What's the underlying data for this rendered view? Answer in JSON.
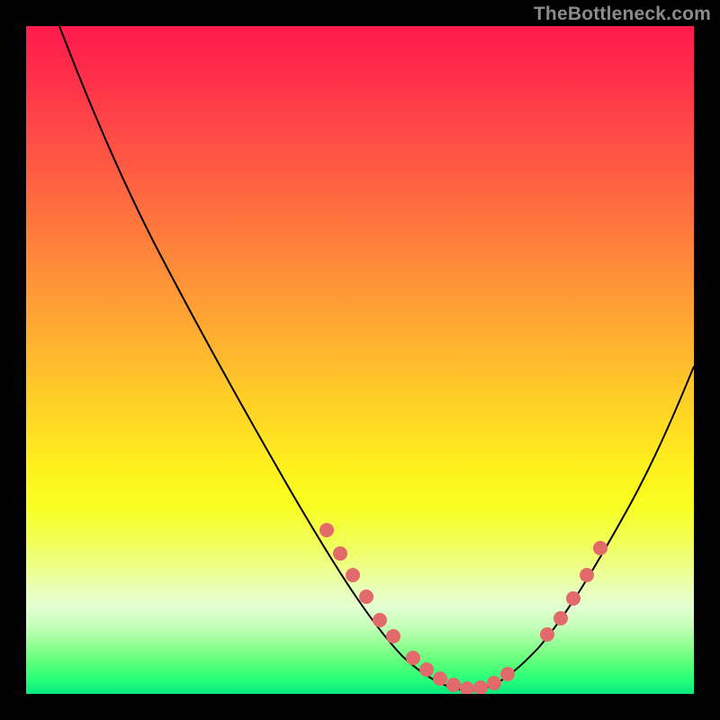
{
  "watermark": "TheBottleneck.com",
  "chart_data": {
    "type": "line",
    "title": "",
    "xlabel": "",
    "ylabel": "",
    "xlim": [
      0,
      100
    ],
    "ylim": [
      0,
      100
    ],
    "grid": false,
    "legend": false,
    "series": [
      {
        "name": "bottleneck-curve",
        "x": [
          5,
          10,
          15,
          20,
          25,
          30,
          35,
          40,
          45,
          50,
          55,
          60,
          63,
          66,
          70,
          75,
          80,
          85,
          90,
          95,
          100
        ],
        "y": [
          100,
          90,
          80,
          70,
          60,
          50,
          41,
          32,
          24,
          16,
          9,
          4,
          2,
          1,
          2,
          5,
          11,
          20,
          30,
          41,
          52
        ]
      }
    ],
    "markers": {
      "left_cluster": {
        "x": [
          45,
          47,
          49,
          51,
          53,
          55
        ],
        "y": [
          24,
          20,
          17,
          14,
          11,
          9
        ]
      },
      "bottom_cluster": {
        "x": [
          58,
          60,
          62,
          64,
          66,
          68,
          70,
          72
        ],
        "y": [
          5,
          4,
          3,
          2,
          1,
          1,
          2,
          3
        ]
      },
      "right_cluster": {
        "x": [
          78,
          80,
          82,
          84,
          86
        ],
        "y": [
          9,
          11,
          14,
          18,
          22
        ]
      }
    },
    "marker_color": "#e36a6a",
    "line_color": "#000000",
    "background": "gradient-red-green"
  }
}
